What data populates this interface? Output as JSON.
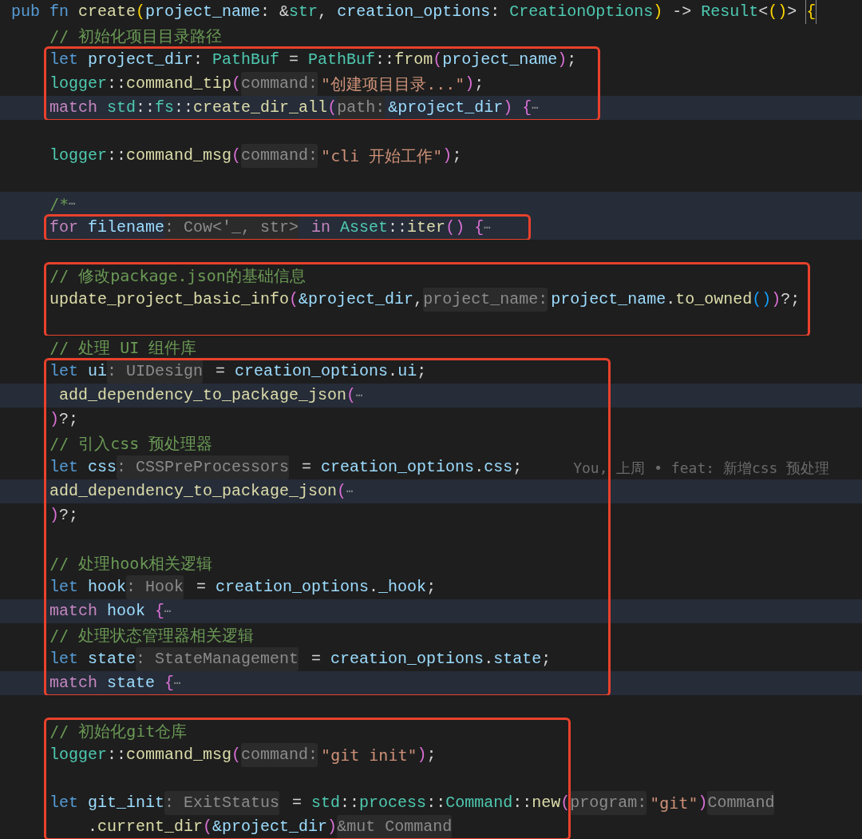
{
  "editor": {
    "lines": [
      {
        "highlighted": false,
        "boxed": false,
        "tokens": [
          {
            "kind": "kw",
            "text": "pub fn "
          },
          {
            "kind": "fn",
            "text": "create"
          },
          {
            "kind": "b0",
            "text": "("
          },
          {
            "kind": "var",
            "text": "project_name"
          },
          {
            "kind": "p",
            "text": ": &"
          },
          {
            "kind": "type",
            "text": "str"
          },
          {
            "kind": "p",
            "text": ", "
          },
          {
            "kind": "var",
            "text": "creation_options"
          },
          {
            "kind": "p",
            "text": ": "
          },
          {
            "kind": "type",
            "text": "CreationOptions"
          },
          {
            "kind": "b0",
            "text": ")"
          },
          {
            "kind": "p",
            "text": " -> "
          },
          {
            "kind": "type",
            "text": "Result"
          },
          {
            "kind": "p",
            "text": "<"
          },
          {
            "kind": "b0",
            "text": "()"
          },
          {
            "kind": "p",
            "text": "> "
          },
          {
            "kind": "cur",
            "text": "{"
          }
        ]
      },
      {
        "highlighted": false,
        "boxed": false,
        "tokens": [
          {
            "kind": "cm",
            "text": "    // 初始化项目目录路径"
          }
        ]
      },
      {
        "highlighted": false,
        "boxed": true,
        "tokens": [
          {
            "kind": "kw",
            "text": "    let "
          },
          {
            "kind": "var",
            "text": "project_dir"
          },
          {
            "kind": "p",
            "text": ": "
          },
          {
            "kind": "type",
            "text": "PathBuf"
          },
          {
            "kind": "p",
            "text": " = "
          },
          {
            "kind": "type",
            "text": "PathBuf"
          },
          {
            "kind": "p",
            "text": "::"
          },
          {
            "kind": "fn",
            "text": "from"
          },
          {
            "kind": "b1",
            "text": "("
          },
          {
            "kind": "var",
            "text": "project_name"
          },
          {
            "kind": "b1",
            "text": ")"
          },
          {
            "kind": "p",
            "text": ";"
          }
        ]
      },
      {
        "highlighted": false,
        "boxed": true,
        "tokens": [
          {
            "kind": "type",
            "text": "    logger"
          },
          {
            "kind": "p",
            "text": "::"
          },
          {
            "kind": "fn",
            "text": "command_tip"
          },
          {
            "kind": "b1",
            "text": "("
          },
          {
            "kind": "hint",
            "text": "command:"
          },
          {
            "kind": "str",
            "text": "\"创建项目目录...\""
          },
          {
            "kind": "b1",
            "text": ")"
          },
          {
            "kind": "p",
            "text": ";"
          }
        ]
      },
      {
        "highlighted": true,
        "boxed": true,
        "tokens": [
          {
            "kind": "ctrl",
            "text": "    match "
          },
          {
            "kind": "type",
            "text": "std"
          },
          {
            "kind": "p",
            "text": "::"
          },
          {
            "kind": "type",
            "text": "fs"
          },
          {
            "kind": "p",
            "text": "::"
          },
          {
            "kind": "fn",
            "text": "create_dir_all"
          },
          {
            "kind": "b1",
            "text": "("
          },
          {
            "kind": "hint",
            "text": "path:"
          },
          {
            "kind": "var",
            "text": "&project_dir"
          },
          {
            "kind": "b1",
            "text": ") {"
          },
          {
            "kind": "fold",
            "text": "⋯"
          }
        ]
      },
      {
        "highlighted": false,
        "boxed": false
      },
      {
        "highlighted": false,
        "boxed": false,
        "tokens": [
          {
            "kind": "type",
            "text": "    logger"
          },
          {
            "kind": "p",
            "text": "::"
          },
          {
            "kind": "fn",
            "text": "command_msg"
          },
          {
            "kind": "b1",
            "text": "("
          },
          {
            "kind": "hint",
            "text": "command:"
          },
          {
            "kind": "str",
            "text": "\"cli 开始工作\""
          },
          {
            "kind": "b1",
            "text": ")"
          },
          {
            "kind": "p",
            "text": ";"
          }
        ]
      },
      {
        "highlighted": false,
        "boxed": false
      },
      {
        "highlighted": true,
        "boxed": false,
        "tokens": [
          {
            "kind": "cm",
            "text": "    /*"
          },
          {
            "kind": "fold",
            "text": "⋯"
          }
        ]
      },
      {
        "highlighted": true,
        "boxed": true,
        "tokens": [
          {
            "kind": "ctrl",
            "text": "    for "
          },
          {
            "kind": "var",
            "text": "filename"
          },
          {
            "kind": "hint",
            "text": ": Cow<'_, str>"
          },
          {
            "kind": "ctrl",
            "text": " in "
          },
          {
            "kind": "type",
            "text": "Asset"
          },
          {
            "kind": "p",
            "text": "::"
          },
          {
            "kind": "fn",
            "text": "iter"
          },
          {
            "kind": "b1",
            "text": "() {"
          },
          {
            "kind": "fold",
            "text": "⋯"
          }
        ]
      },
      {
        "highlighted": false,
        "boxed": false
      },
      {
        "highlighted": false,
        "boxed": true,
        "tokens": [
          {
            "kind": "cm",
            "text": "    // 修改package.json的基础信息"
          }
        ]
      },
      {
        "highlighted": false,
        "boxed": true,
        "tokens": [
          {
            "kind": "fn",
            "text": "    update_project_basic_info"
          },
          {
            "kind": "b1",
            "text": "("
          },
          {
            "kind": "var",
            "text": "&project_dir"
          },
          {
            "kind": "p",
            "text": ","
          },
          {
            "kind": "hint",
            "text": "project_name:"
          },
          {
            "kind": "var",
            "text": "project_name"
          },
          {
            "kind": "p",
            "text": "."
          },
          {
            "kind": "fn",
            "text": "to_owned"
          },
          {
            "kind": "b2",
            "text": "()"
          },
          {
            "kind": "b1",
            "text": ")"
          },
          {
            "kind": "p",
            "text": "?;"
          }
        ]
      },
      {
        "highlighted": false,
        "boxed": true
      },
      {
        "highlighted": false,
        "boxed": false,
        "tokens": [
          {
            "kind": "cm",
            "text": "    // 处理 UI 组件库"
          }
        ]
      },
      {
        "highlighted": false,
        "boxed": true,
        "tokens": [
          {
            "kind": "kw",
            "text": "    let "
          },
          {
            "kind": "var",
            "text": "ui"
          },
          {
            "kind": "hint",
            "text": ": UIDesign"
          },
          {
            "kind": "p",
            "text": " = "
          },
          {
            "kind": "var",
            "text": "creation_options"
          },
          {
            "kind": "p",
            "text": "."
          },
          {
            "kind": "var",
            "text": "ui"
          },
          {
            "kind": "p",
            "text": ";"
          }
        ]
      },
      {
        "highlighted": true,
        "boxed": true,
        "tokens": [
          {
            "kind": "fn",
            "text": "     add_dependency_to_package_json"
          },
          {
            "kind": "b1",
            "text": "("
          },
          {
            "kind": "fold",
            "text": "⋯"
          }
        ]
      },
      {
        "highlighted": false,
        "boxed": true,
        "tokens": [
          {
            "kind": "b1",
            "text": "    )"
          },
          {
            "kind": "p",
            "text": "?;"
          }
        ]
      },
      {
        "highlighted": false,
        "boxed": true,
        "tokens": [
          {
            "kind": "cm",
            "text": "    // 引入css 预处理器"
          }
        ]
      },
      {
        "highlighted": false,
        "boxed": true,
        "tokens": [
          {
            "kind": "kw",
            "text": "    let "
          },
          {
            "kind": "var",
            "text": "css"
          },
          {
            "kind": "hint",
            "text": ": CSSPreProcessors"
          },
          {
            "kind": "p",
            "text": " = "
          },
          {
            "kind": "var",
            "text": "creation_options"
          },
          {
            "kind": "p",
            "text": "."
          },
          {
            "kind": "var",
            "text": "css"
          },
          {
            "kind": "p",
            "text": ";"
          },
          {
            "kind": "blame",
            "text": "You, 上周 • feat: 新增css 预处理"
          }
        ]
      },
      {
        "highlighted": true,
        "boxed": true,
        "tokens": [
          {
            "kind": "fn",
            "text": "    add_dependency_to_package_json"
          },
          {
            "kind": "b1",
            "text": "("
          },
          {
            "kind": "fold",
            "text": "⋯"
          }
        ]
      },
      {
        "highlighted": false,
        "boxed": true,
        "tokens": [
          {
            "kind": "b1",
            "text": "    )"
          },
          {
            "kind": "p",
            "text": "?;"
          }
        ]
      },
      {
        "highlighted": false,
        "boxed": true
      },
      {
        "highlighted": false,
        "boxed": true,
        "tokens": [
          {
            "kind": "cm",
            "text": "    // 处理hook相关逻辑"
          }
        ]
      },
      {
        "highlighted": false,
        "boxed": true,
        "tokens": [
          {
            "kind": "kw",
            "text": "    let "
          },
          {
            "kind": "var",
            "text": "hook"
          },
          {
            "kind": "hint",
            "text": ": Hook"
          },
          {
            "kind": "p",
            "text": " = "
          },
          {
            "kind": "var",
            "text": "creation_options"
          },
          {
            "kind": "p",
            "text": "."
          },
          {
            "kind": "var",
            "text": "_hook"
          },
          {
            "kind": "p",
            "text": ";"
          }
        ]
      },
      {
        "highlighted": true,
        "boxed": true,
        "tokens": [
          {
            "kind": "ctrl",
            "text": "    match "
          },
          {
            "kind": "var",
            "text": "hook"
          },
          {
            "kind": "b1",
            "text": " {"
          },
          {
            "kind": "fold",
            "text": "⋯"
          }
        ]
      },
      {
        "highlighted": false,
        "boxed": true,
        "tokens": [
          {
            "kind": "cm",
            "text": "    // 处理状态管理器相关逻辑"
          }
        ]
      },
      {
        "highlighted": false,
        "boxed": true,
        "tokens": [
          {
            "kind": "kw",
            "text": "    let "
          },
          {
            "kind": "var",
            "text": "state"
          },
          {
            "kind": "hint",
            "text": ": StateManagement"
          },
          {
            "kind": "p",
            "text": " = "
          },
          {
            "kind": "var",
            "text": "creation_options"
          },
          {
            "kind": "p",
            "text": "."
          },
          {
            "kind": "var",
            "text": "state"
          },
          {
            "kind": "p",
            "text": ";"
          }
        ]
      },
      {
        "highlighted": true,
        "boxed": true,
        "tokens": [
          {
            "kind": "ctrl",
            "text": "    match "
          },
          {
            "kind": "var",
            "text": "state"
          },
          {
            "kind": "b1",
            "text": " {"
          },
          {
            "kind": "fold",
            "text": "⋯"
          }
        ]
      },
      {
        "highlighted": false,
        "boxed": false
      },
      {
        "highlighted": false,
        "boxed": true,
        "tokens": [
          {
            "kind": "cm",
            "text": "    // 初始化git仓库"
          }
        ]
      },
      {
        "highlighted": false,
        "boxed": true,
        "tokens": [
          {
            "kind": "type",
            "text": "    logger"
          },
          {
            "kind": "p",
            "text": "::"
          },
          {
            "kind": "fn",
            "text": "command_msg"
          },
          {
            "kind": "b1",
            "text": "("
          },
          {
            "kind": "hint",
            "text": "command:"
          },
          {
            "kind": "str",
            "text": "\"git init\""
          },
          {
            "kind": "b1",
            "text": ")"
          },
          {
            "kind": "p",
            "text": ";"
          }
        ]
      },
      {
        "highlighted": false,
        "boxed": true
      },
      {
        "highlighted": false,
        "boxed": true,
        "tokens": [
          {
            "kind": "kw",
            "text": "    let "
          },
          {
            "kind": "var",
            "text": "git_init"
          },
          {
            "kind": "hint",
            "text": ": ExitStatus"
          },
          {
            "kind": "p",
            "text": " = "
          },
          {
            "kind": "type",
            "text": "std"
          },
          {
            "kind": "p",
            "text": "::"
          },
          {
            "kind": "type",
            "text": "process"
          },
          {
            "kind": "p",
            "text": "::"
          },
          {
            "kind": "type",
            "text": "Command"
          },
          {
            "kind": "p",
            "text": "::"
          },
          {
            "kind": "fn",
            "text": "new"
          },
          {
            "kind": "b1",
            "text": "("
          },
          {
            "kind": "hint",
            "text": "program:"
          },
          {
            "kind": "str",
            "text": "\"git\""
          },
          {
            "kind": "b1",
            "text": ")"
          },
          {
            "kind": "hint",
            "text": "Command"
          }
        ]
      },
      {
        "highlighted": false,
        "boxed": true,
        "tokens": [
          {
            "kind": "p",
            "text": "        ."
          },
          {
            "kind": "fn",
            "text": "current_dir"
          },
          {
            "kind": "b1",
            "text": "("
          },
          {
            "kind": "var",
            "text": "&project_dir"
          },
          {
            "kind": "b1",
            "text": ")"
          },
          {
            "kind": "hint",
            "text": "&mut Command"
          }
        ]
      }
    ]
  }
}
